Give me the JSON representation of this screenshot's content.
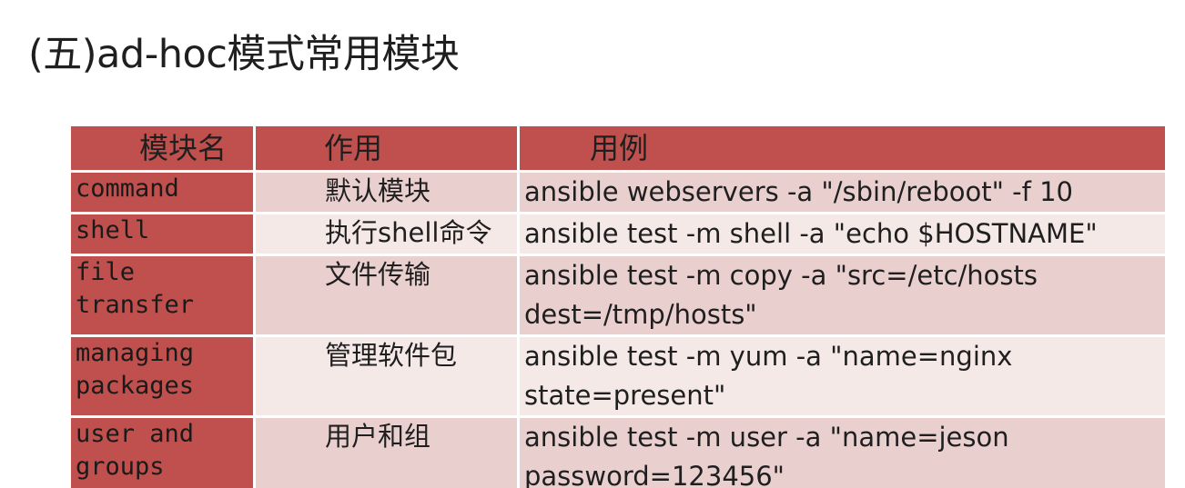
{
  "title": "(五)ad-hoc模式常用模块",
  "table": {
    "headers": [
      "模块名",
      "作用",
      "用例"
    ],
    "rows": [
      {
        "name": "command",
        "purpose": "默认模块",
        "example": "ansible webservers -a \"/sbin/reboot\" -f 10"
      },
      {
        "name": "shell",
        "purpose": "执行shell命令",
        "example": "ansible test -m shell -a \"echo $HOSTNAME\""
      },
      {
        "name_line1": "file",
        "name_line2": "transfer",
        "purpose": "文件传输",
        "example_line1": "ansible test -m copy -a \"src=/etc/hosts",
        "example_line2": "dest=/tmp/hosts\""
      },
      {
        "name_line1": "managing",
        "name_line2": "packages",
        "purpose": "管理软件包",
        "example_line1": "ansible test -m yum -a \"name=nginx",
        "example_line2": "state=present\""
      },
      {
        "name_line1": "user and",
        "name_line2": "groups",
        "purpose": "用户和组",
        "example_line1": "ansible test -m user -a \"name=jeson",
        "example_line2": "password=123456\""
      }
    ]
  },
  "colors": {
    "header_bg": "#c0504d",
    "name_col_bg": "#c0504d",
    "row_odd_bg": "#e9d0cf",
    "row_even_bg": "#f5e9e8"
  }
}
